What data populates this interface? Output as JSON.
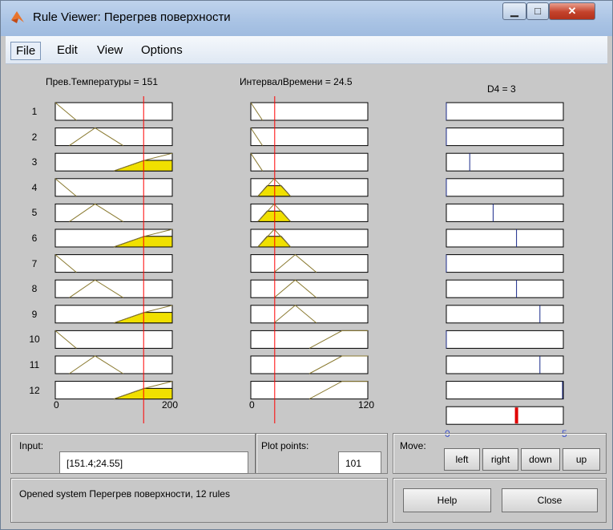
{
  "window": {
    "title": "Rule Viewer: Перегрев поверхности",
    "minimize_glyph": "▁",
    "maximize_glyph": "□",
    "close_glyph": "✕"
  },
  "menu": [
    "File",
    "Edit",
    "View",
    "Options"
  ],
  "inputs": [
    {
      "label": "Прев.Температуры = 151",
      "value": 151,
      "range": [
        0,
        200
      ],
      "tick_min": "0",
      "tick_max": "200"
    },
    {
      "label": "ИнтервалВремени = 24.5",
      "value": 24.5,
      "range": [
        0,
        120
      ],
      "tick_min": "0",
      "tick_max": "120"
    }
  ],
  "output": {
    "label": "D4 = 3",
    "value": 3,
    "range": [
      0,
      5
    ],
    "tick_min": "0",
    "tick_max": "5"
  },
  "rules": [
    {
      "number": "1",
      "in1": "low",
      "in2": "low",
      "out": 0
    },
    {
      "number": "2",
      "in1": "mid",
      "in2": "low",
      "out": 0
    },
    {
      "number": "3",
      "in1": "high",
      "in2": "low",
      "out": 1
    },
    {
      "number": "4",
      "in1": "low",
      "in2": "mid",
      "out": 0
    },
    {
      "number": "5",
      "in1": "mid",
      "in2": "mid",
      "out": 2
    },
    {
      "number": "6",
      "in1": "high",
      "in2": "mid",
      "out": 3
    },
    {
      "number": "7",
      "in1": "low",
      "in2": "high",
      "out": 0
    },
    {
      "number": "8",
      "in1": "mid",
      "in2": "high",
      "out": 3
    },
    {
      "number": "9",
      "in1": "high",
      "in2": "high",
      "out": 4
    },
    {
      "number": "10",
      "in1": "low",
      "in2": "vhigh",
      "out": 0
    },
    {
      "number": "11",
      "in1": "mid",
      "in2": "vhigh",
      "out": 4
    },
    {
      "number": "12",
      "in1": "high",
      "in2": "vhigh",
      "out": 5
    }
  ],
  "controls": {
    "input_label": "Input:",
    "input_value": "[151.4;24.55]",
    "plot_points_label": "Plot points:",
    "plot_points_value": "101",
    "move_label": "Move:",
    "move_buttons": [
      "left",
      "right",
      "down",
      "up"
    ],
    "status": "Opened system Перегрев поверхности, 12 rules",
    "help": "Help",
    "close": "Close"
  },
  "colors": {
    "fill": "#f0e000",
    "curve": "#8a7a30",
    "cursor": "#ff0000",
    "output_spike": "#1a2a8a",
    "output_result": "#e00000",
    "tick_blue": "#3a4fcf"
  }
}
